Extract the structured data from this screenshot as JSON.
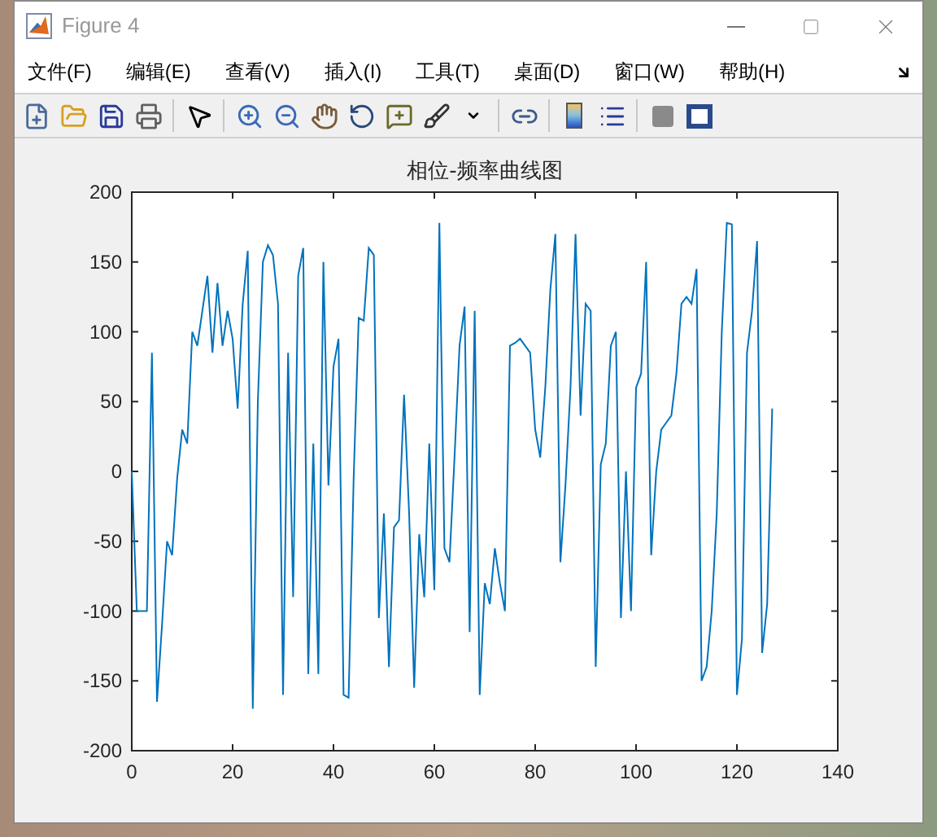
{
  "window": {
    "title": "Figure 4"
  },
  "menu": [
    {
      "label": "文件(F)"
    },
    {
      "label": "编辑(E)"
    },
    {
      "label": "查看(V)"
    },
    {
      "label": "插入(I)"
    },
    {
      "label": "工具(T)"
    },
    {
      "label": "桌面(D)"
    },
    {
      "label": "窗口(W)"
    },
    {
      "label": "帮助(H)"
    }
  ],
  "figure": {
    "chart_data": {
      "type": "line",
      "title": "相位-频率曲线图",
      "x": [
        0,
        1,
        2,
        3,
        4,
        5,
        6,
        7,
        8,
        9,
        10,
        11,
        12,
        13,
        14,
        15,
        16,
        17,
        18,
        19,
        20,
        21,
        22,
        23,
        24,
        25,
        26,
        27,
        28,
        29,
        30,
        31,
        32,
        33,
        34,
        35,
        36,
        37,
        38,
        39,
        40,
        41,
        42,
        43,
        44,
        45,
        46,
        47,
        48,
        49,
        50,
        51,
        52,
        53,
        54,
        55,
        56,
        57,
        58,
        59,
        60,
        61,
        62,
        63,
        64,
        65,
        66,
        67,
        68,
        69,
        70,
        71,
        72,
        73,
        74,
        75,
        76,
        77,
        78,
        79,
        80,
        81,
        82,
        83,
        84,
        85,
        86,
        87,
        88,
        89,
        90,
        91,
        92,
        93,
        94,
        95,
        96,
        97,
        98,
        99,
        100,
        101,
        102,
        103,
        104,
        105,
        106,
        107,
        108,
        109,
        110,
        111,
        112,
        113,
        114,
        115,
        116,
        117,
        118,
        119,
        120,
        121,
        122,
        123,
        124,
        125,
        126,
        127
      ],
      "series": [
        {
          "color": "#0072bd",
          "values": [
            0,
            -100,
            -100,
            -100,
            85,
            -165,
            -110,
            -50,
            -60,
            -5,
            30,
            20,
            100,
            90,
            115,
            140,
            85,
            135,
            90,
            115,
            95,
            45,
            120,
            158,
            -170,
            50,
            150,
            162,
            155,
            120,
            -160,
            85,
            -90,
            140,
            160,
            -145,
            20,
            -145,
            150,
            -10,
            75,
            95,
            -160,
            -162,
            -5,
            110,
            108,
            160,
            155,
            -105,
            -30,
            -140,
            -40,
            -35,
            55,
            -30,
            -155,
            -45,
            -90,
            20,
            -85,
            178,
            -55,
            -65,
            10,
            90,
            118,
            -115,
            115,
            -160,
            -80,
            -95,
            -55,
            -80,
            -100,
            90,
            92,
            95,
            90,
            85,
            30,
            10,
            60,
            130,
            170,
            -65,
            -10,
            60,
            170,
            40,
            120,
            115,
            -140,
            5,
            20,
            90,
            100,
            -105,
            0,
            -100,
            60,
            70,
            150,
            -60,
            0,
            30,
            35,
            40,
            70,
            120,
            125,
            120,
            145,
            -150,
            -140,
            -100,
            -30,
            100,
            178,
            177,
            -160,
            -120,
            85,
            115,
            165,
            -130,
            -95,
            45
          ]
        }
      ],
      "xlim": [
        0,
        140
      ],
      "ylim": [
        -200,
        200
      ],
      "xticks": [
        0,
        20,
        40,
        60,
        80,
        100,
        120,
        140
      ],
      "yticks": [
        -200,
        -150,
        -100,
        -50,
        0,
        50,
        100,
        150,
        200
      ]
    }
  }
}
